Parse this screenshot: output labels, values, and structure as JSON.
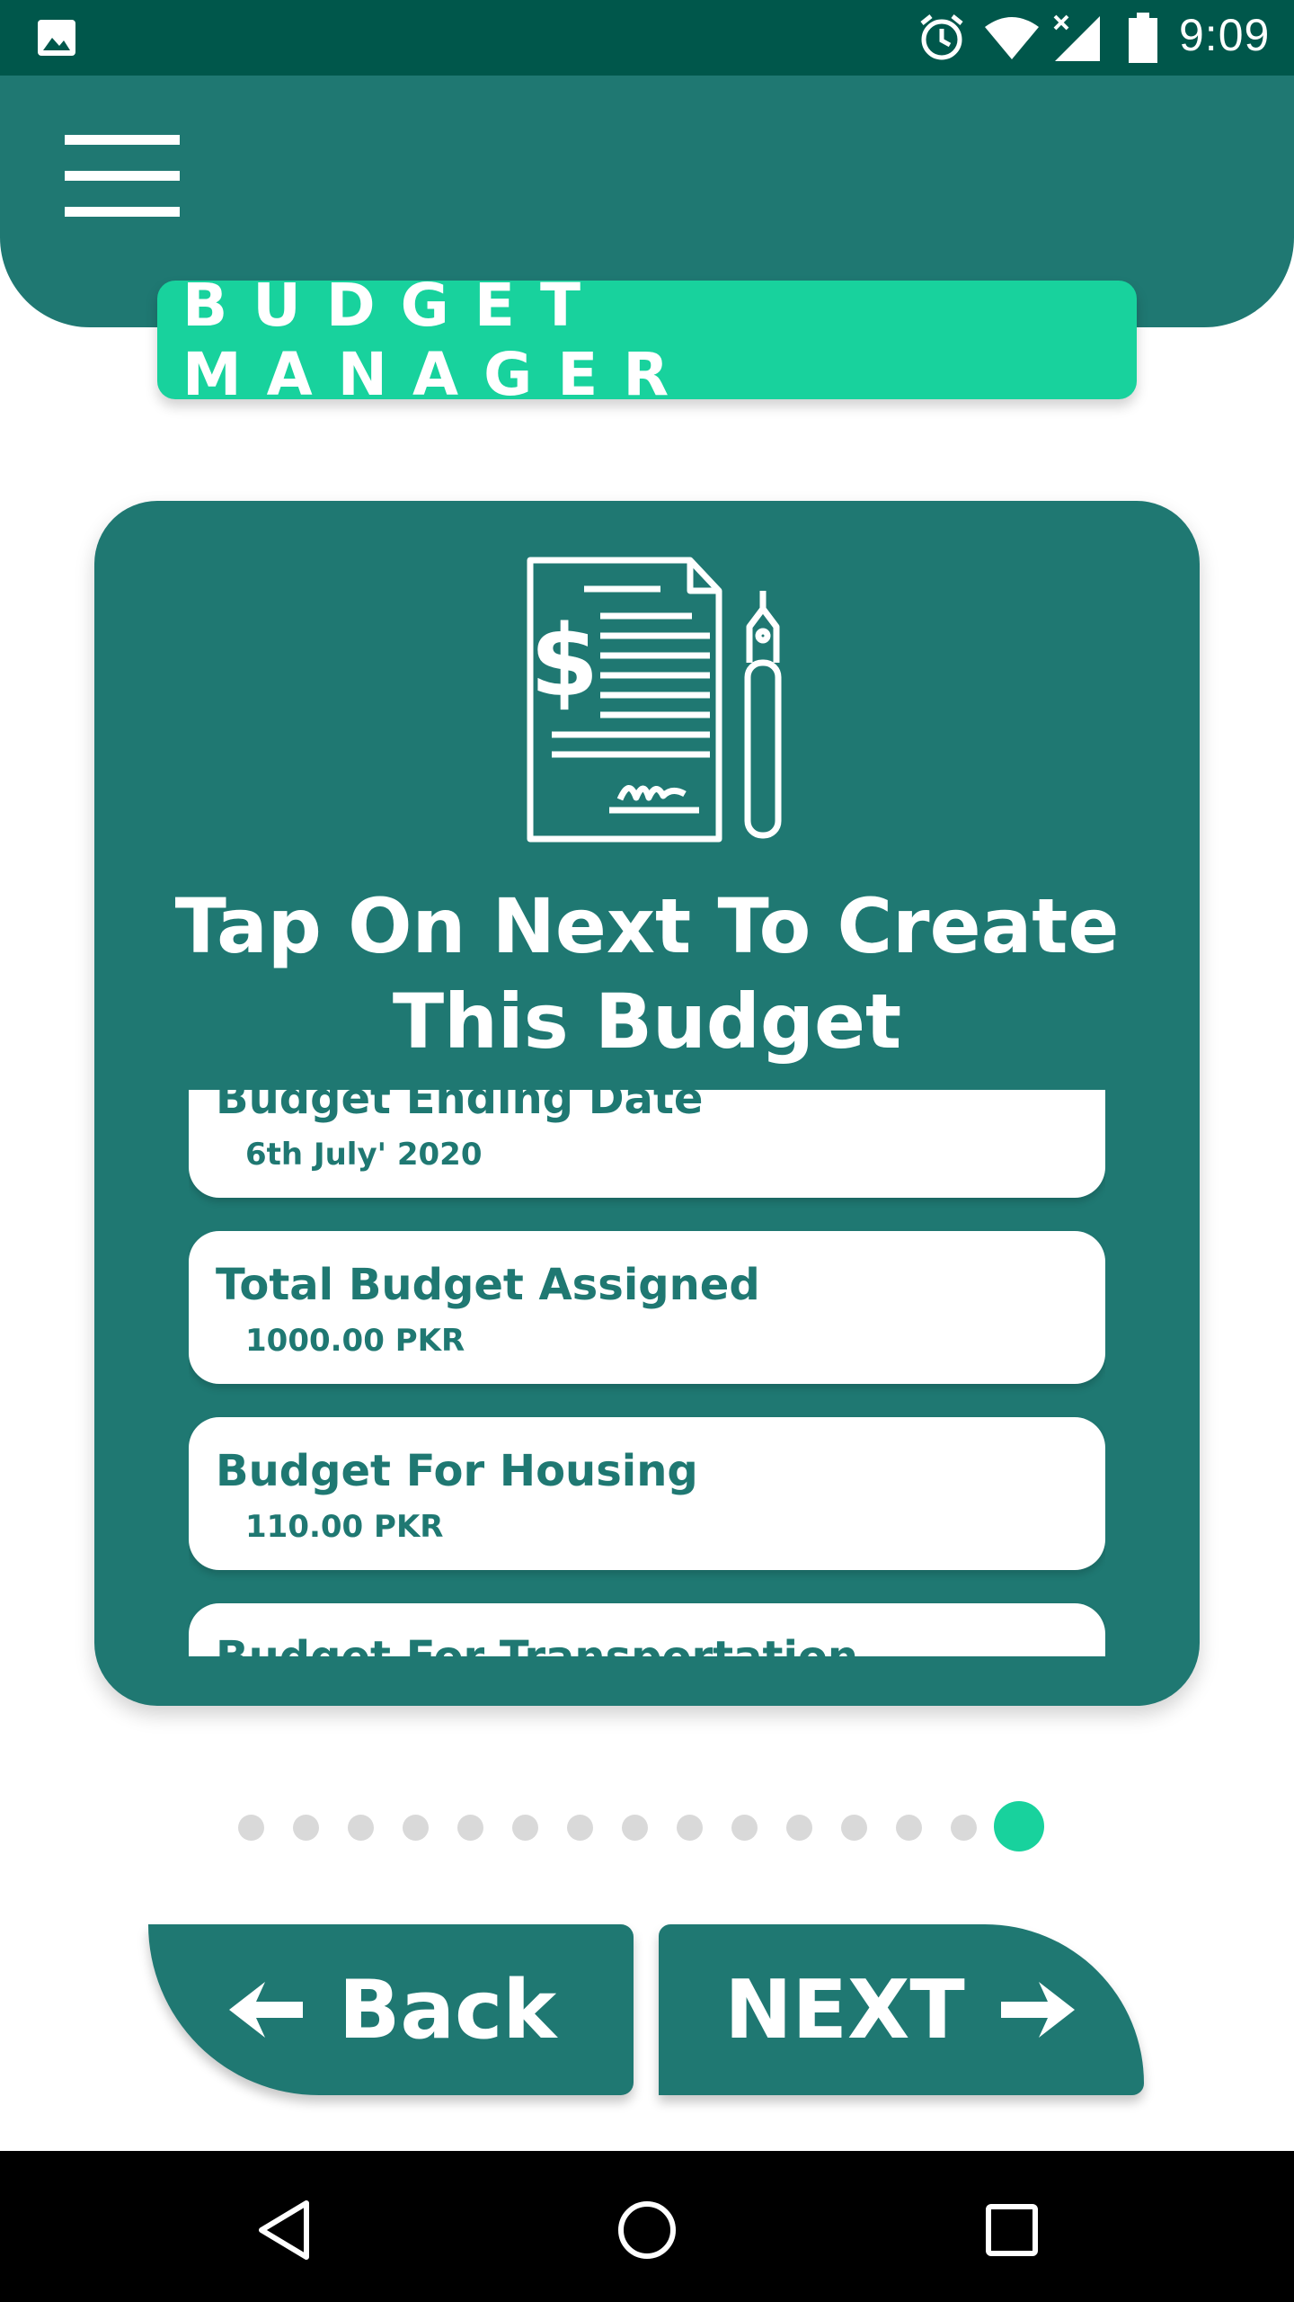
{
  "status_bar": {
    "time": "9:09",
    "icons": [
      "image-icon",
      "alarm-icon",
      "wifi-icon",
      "signal-icon",
      "battery-icon"
    ]
  },
  "header": {
    "app_title": "BUDGET MANAGER",
    "menu_icon": "hamburger-menu-icon"
  },
  "card": {
    "icon": "budget-document-pen-icon",
    "title": "Tap On Next To Create This Budget",
    "items": [
      {
        "label": "Budget Ending Date",
        "value": "6th July' 2020"
      },
      {
        "label": "Total Budget Assigned",
        "value": "1000.00 PKR"
      },
      {
        "label": "Budget For Housing",
        "value": "110.00 PKR"
      },
      {
        "label": "Budget For Transportation",
        "value": ""
      }
    ]
  },
  "pager": {
    "total": 15,
    "active_index": 14
  },
  "buttons": {
    "back_label": "Back",
    "next_label": "NEXT"
  },
  "colors": {
    "primary": "#1f7872",
    "accent": "#18d29d",
    "status_bar": "#00574b",
    "dot_inactive": "#d9d9d9"
  },
  "nav_bar": {
    "icons": [
      "back-triangle-icon",
      "home-circle-icon",
      "recents-square-icon"
    ]
  }
}
